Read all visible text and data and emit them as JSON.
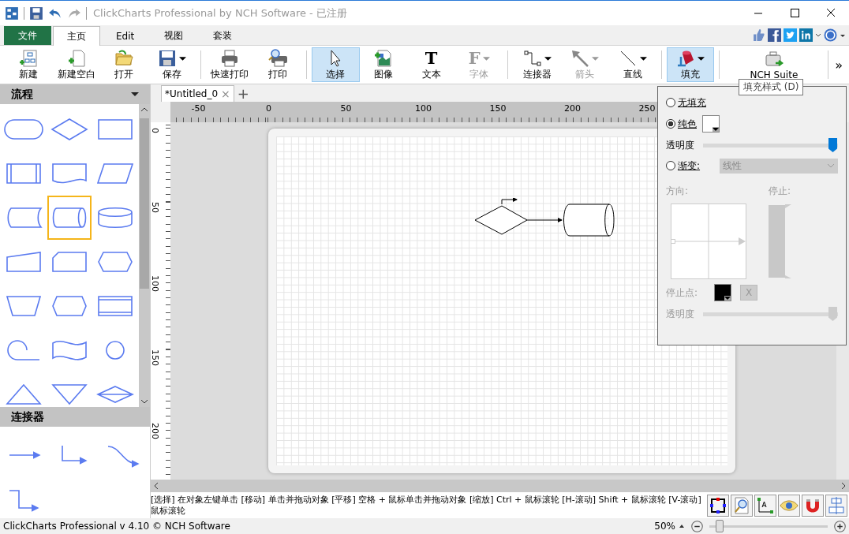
{
  "window": {
    "title": "ClickCharts Professional by NCH Software - 已注册"
  },
  "menu_tabs": [
    {
      "label": "文件",
      "kind": "file",
      "selected": false
    },
    {
      "label": "主页",
      "kind": "tab",
      "selected": true
    },
    {
      "label": "Edit",
      "kind": "tab",
      "selected": false
    },
    {
      "label": "视图",
      "kind": "tab",
      "selected": false
    },
    {
      "label": "套装",
      "kind": "tab",
      "selected": false
    }
  ],
  "ribbon": [
    {
      "label": "新建",
      "kind": "new",
      "dropdown": false,
      "disabled": false,
      "selected": false
    },
    {
      "label": "新建空白",
      "kind": "blank",
      "dropdown": false,
      "disabled": false,
      "selected": false
    },
    {
      "label": "打开",
      "kind": "open",
      "dropdown": false,
      "disabled": false,
      "selected": false
    },
    {
      "label": "保存",
      "kind": "save",
      "dropdown": true,
      "disabled": false,
      "selected": false
    },
    {
      "label": "快速打印",
      "kind": "print",
      "dropdown": false,
      "disabled": false,
      "selected": false
    },
    {
      "label": "打印",
      "kind": "preview",
      "dropdown": false,
      "disabled": false,
      "selected": false
    },
    {
      "label": "选择",
      "kind": "pointer",
      "dropdown": false,
      "disabled": false,
      "selected": true
    },
    {
      "label": "图像",
      "kind": "image",
      "dropdown": false,
      "disabled": false,
      "selected": false
    },
    {
      "label": "文本",
      "kind": "text",
      "dropdown": false,
      "disabled": false,
      "selected": false
    },
    {
      "label": "字体",
      "kind": "font",
      "dropdown": true,
      "disabled": true,
      "selected": false
    },
    {
      "label": "连接器",
      "kind": "connector",
      "dropdown": true,
      "disabled": false,
      "selected": false
    },
    {
      "label": "箭头",
      "kind": "arrow",
      "dropdown": true,
      "disabled": true,
      "selected": false
    },
    {
      "label": "直线",
      "kind": "line",
      "dropdown": true,
      "disabled": false,
      "selected": false
    },
    {
      "label": "填充",
      "kind": "fill",
      "dropdown": true,
      "disabled": false,
      "selected": true
    },
    {
      "label": "NCH Suite",
      "kind": "suite",
      "dropdown": false,
      "disabled": false,
      "selected": false
    }
  ],
  "ribbon_glyphs": {
    "text": "T",
    "font": "F",
    "more": "»"
  },
  "tooltip": "填充样式 (D)",
  "sidebar": {
    "sections": [
      {
        "title": "流程",
        "dropdown": true,
        "shapes": [
          {
            "kind": "terminator",
            "selected": false
          },
          {
            "kind": "decision",
            "selected": false
          },
          {
            "kind": "process",
            "selected": false
          },
          {
            "kind": "predefined",
            "selected": false
          },
          {
            "kind": "document",
            "selected": false
          },
          {
            "kind": "data",
            "selected": false
          },
          {
            "kind": "stored",
            "selected": false
          },
          {
            "kind": "direct",
            "selected": true
          },
          {
            "kind": "disk",
            "selected": false
          },
          {
            "kind": "manual-input",
            "selected": false
          },
          {
            "kind": "card",
            "selected": false
          },
          {
            "kind": "prep",
            "selected": false
          },
          {
            "kind": "manual-op",
            "selected": false
          },
          {
            "kind": "hexagon",
            "selected": false
          },
          {
            "kind": "internal",
            "selected": false
          },
          {
            "kind": "sequential",
            "selected": false
          },
          {
            "kind": "tape",
            "selected": false
          },
          {
            "kind": "circle",
            "selected": false
          },
          {
            "kind": "extract",
            "selected": false
          },
          {
            "kind": "merge",
            "selected": false
          },
          {
            "kind": "collate",
            "selected": false
          }
        ]
      },
      {
        "title": "连接器",
        "dropdown": false,
        "shapes": [
          {
            "kind": "straight-arrow",
            "selected": false
          },
          {
            "kind": "elbow-arrow",
            "selected": false
          },
          {
            "kind": "curve-arrow",
            "selected": false
          },
          {
            "kind": "elbow-down-arrow",
            "selected": false
          }
        ]
      }
    ]
  },
  "document_tabs": [
    {
      "label": "*Untitled_0",
      "close": "×",
      "selected": true
    }
  ],
  "new_tab": "+",
  "ruler": {
    "horizontal": [
      "-50",
      "0",
      "50",
      "100",
      "150",
      "200",
      "250"
    ],
    "vertical": [
      "0",
      "50",
      "100",
      "150",
      "200"
    ]
  },
  "fill_panel": {
    "options": [
      {
        "label": "无填充",
        "selected": false
      },
      {
        "label": "纯色",
        "selected": true
      },
      {
        "label": "渐变:",
        "selected": false
      }
    ],
    "transparency_label": "透明度",
    "transparency": {
      "level": 1
    },
    "gradient_type": "线性",
    "direction_label": "方向:",
    "stop_label": "停止:",
    "stop_point_label": "停止点:",
    "delete": "X",
    "stop_transparency_label": "透明度",
    "stop_transparency": {
      "level": 1
    }
  },
  "status_hint": "[选择] 在对象左键单击 [移动] 单击并拖动对象 [平移] 空格 + 鼠标单击并拖动对象  [缩放] Ctrl + 鼠标滚轮  [H-滚动] Shift + 鼠标滚轮  [V-滚动] 鼠标滚轮",
  "status_bar": {
    "app": "ClickCharts Professional v 4.10 © NCH Software",
    "zoom": "50%",
    "zoom_slider": {
      "level": 0.05
    }
  }
}
